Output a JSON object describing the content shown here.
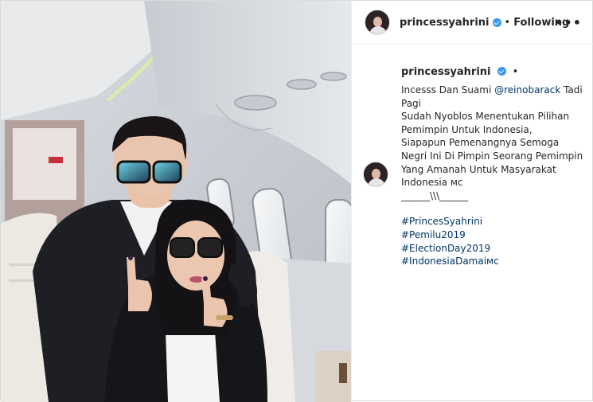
{
  "post": {
    "username": "princessyahrini",
    "separator": "•",
    "follow_status": "Following",
    "more_label": "•••"
  },
  "caption": {
    "username": "princessyahrini",
    "dot": "•",
    "line1_text": "Incesss Dan Suami ",
    "line1_mention": "@reinobarack",
    "line1_tail": " Tadi",
    "line2": "Pagi",
    "line3": "Sudah Nyoblos Menentukan Pilihan",
    "line4": "Pemimpin Untuk Indonesia,",
    "line5": "Siapapun Pemenangnya Semoga",
    "line6": "Negri Ini Di Pimpin Seorang Pemimpin",
    "line7": "Yang Amanah Untuk Masyarakat",
    "line8": "Indonesia ᴍᴄ",
    "line9": "______\\\\\\______",
    "hashtags": [
      "#PrincesSyahrini",
      "#Pemilu2019",
      "#ElectionDay2019",
      "#IndonesiaDamaiᴍᴄ"
    ]
  },
  "colors": {
    "link": "#003569",
    "text": "#262626",
    "verified": "#3897f0"
  },
  "icons": [
    "verified-badge-icon",
    "more-options-icon"
  ]
}
